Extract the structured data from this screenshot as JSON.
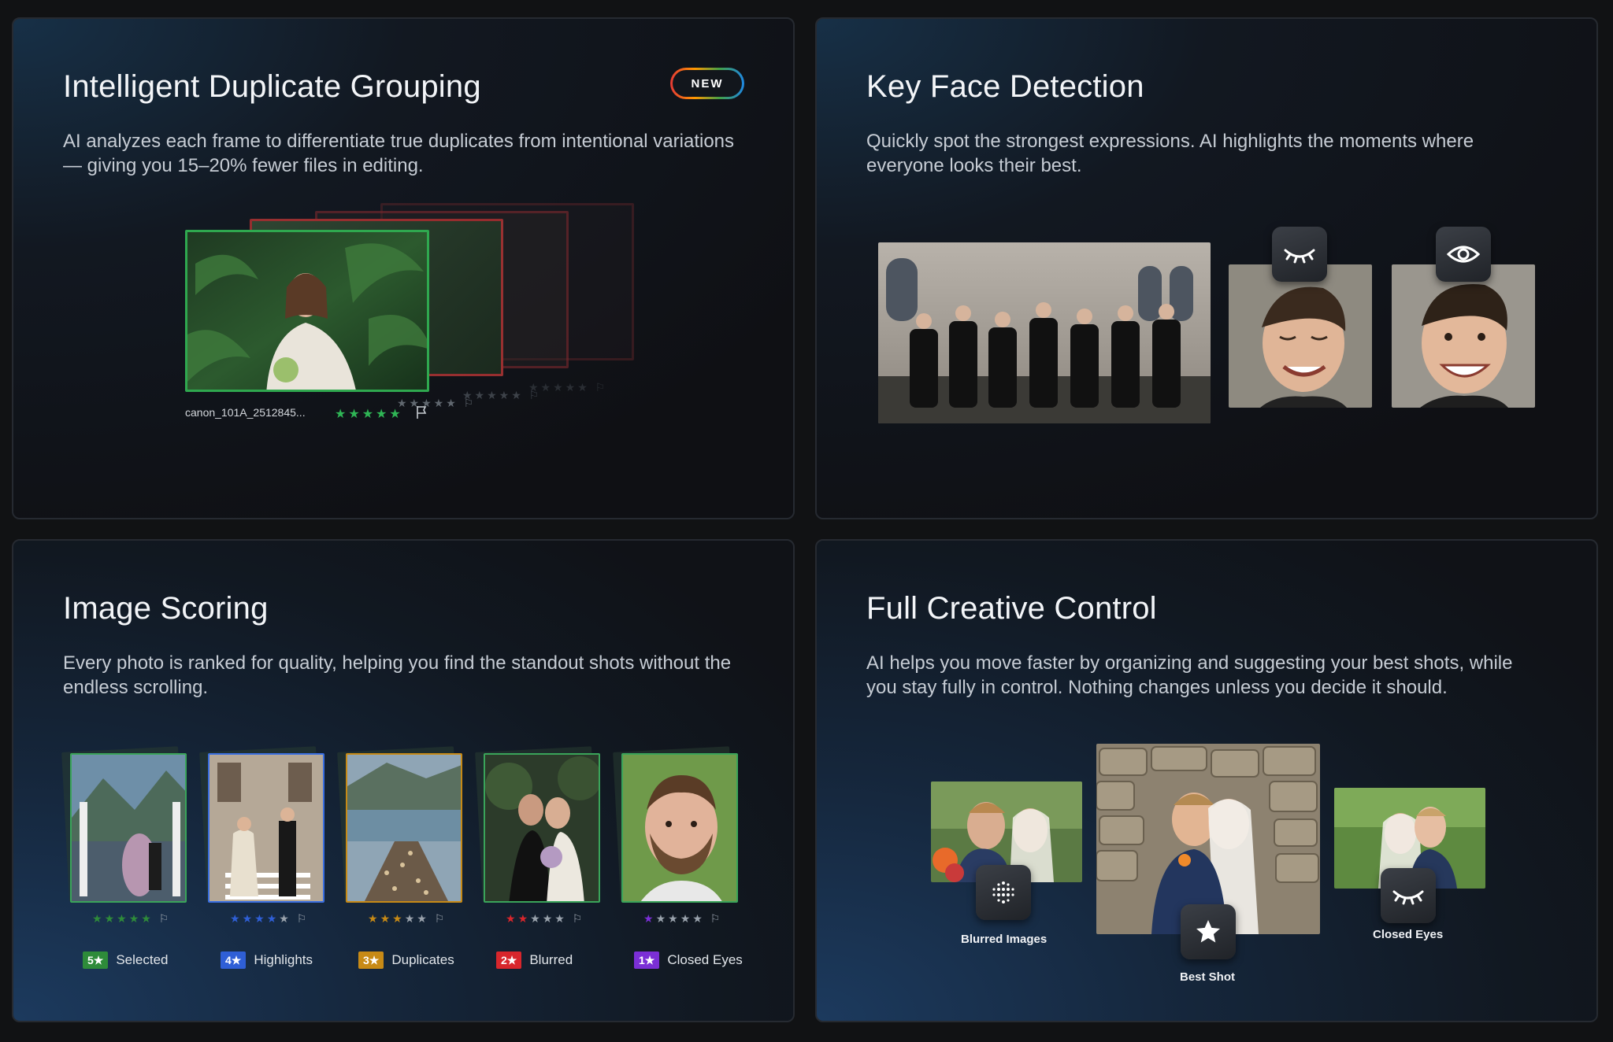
{
  "cards": {
    "duplicates": {
      "title": "Intelligent Duplicate Grouping",
      "badge": "NEW",
      "description": "AI analyzes each frame to differentiate true duplicates from intentional variations — giving you 15–20% fewer files in editing.",
      "filename": "canon_101A_2512845...",
      "stars": "★★★★★"
    },
    "face": {
      "title": "Key Face Detection",
      "description": "Quickly spot the strongest expressions. AI highlights the moments where everyone looks their best."
    },
    "scoring": {
      "title": "Image Scoring",
      "description": "Every photo is ranked for quality, helping you find the standout shots without the endless scrolling.",
      "items": [
        {
          "rating": 5,
          "chip": "5★",
          "label": "Selected",
          "color": "#2e8b3a",
          "stars": "★★★★★"
        },
        {
          "rating": 4,
          "chip": "4★",
          "label": "Highlights",
          "color": "#2f5fd6",
          "stars": "★★★★★"
        },
        {
          "rating": 3,
          "chip": "3★",
          "label": "Duplicates",
          "color": "#c78a16",
          "stars": "★★★★★"
        },
        {
          "rating": 2,
          "chip": "2★",
          "label": "Blurred",
          "color": "#d8262c",
          "stars": "★★★★★"
        },
        {
          "rating": 1,
          "chip": "1★",
          "label": "Closed Eyes",
          "color": "#7b2fd6",
          "stars": "★★★★★"
        }
      ]
    },
    "control": {
      "title": "Full Creative Control",
      "description": "AI helps you move faster by organizing and suggesting your best shots, while you stay fully in control. Nothing changes unless you decide it should.",
      "labels": {
        "blurred": "Blurred Images",
        "best": "Best Shot",
        "closed": "Closed Eyes"
      }
    }
  },
  "icons": [
    "closed-eye-icon",
    "open-eye-icon",
    "blur-dots-icon",
    "star-icon",
    "flag-icon"
  ]
}
